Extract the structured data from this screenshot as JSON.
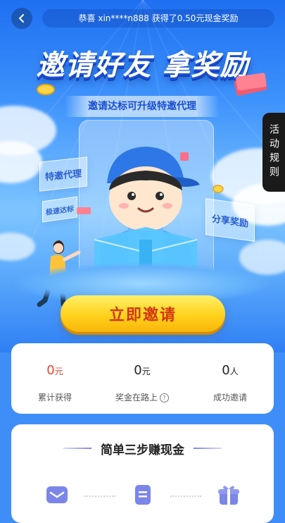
{
  "header": {
    "back_icon": "chevron-left-icon",
    "ticker_text": "恭喜 xin****n888 获得了0.50元现金奖励"
  },
  "hero": {
    "headline": "邀请好友 拿奖励",
    "subtitle": "邀请达标可升级特邀代理",
    "tags": {
      "special_agent": "特邀代理",
      "fast_reach": "极速达标",
      "share_reward": "分享奖励"
    },
    "cta_label": "立即邀请"
  },
  "side_button": {
    "label": "活动规则"
  },
  "stats": {
    "total_earned": {
      "value": "0",
      "unit": "元",
      "label": "累计获得",
      "color": "#e8442f"
    },
    "pending": {
      "value": "0",
      "unit": "元",
      "label": "奖金在路上",
      "help_icon": "question-circle-icon"
    },
    "invited": {
      "value": "0",
      "unit": "人",
      "label": "成功邀请"
    }
  },
  "steps": {
    "title": "简单三步赚现金",
    "icons": [
      "envelope-icon",
      "document-icon",
      "gift-icon"
    ]
  },
  "colors": {
    "primary_blue": "#3f8ef7",
    "cta_yellow": "#ffd21b",
    "cta_text": "#d1360f",
    "accent_purple": "#7b86e8"
  }
}
